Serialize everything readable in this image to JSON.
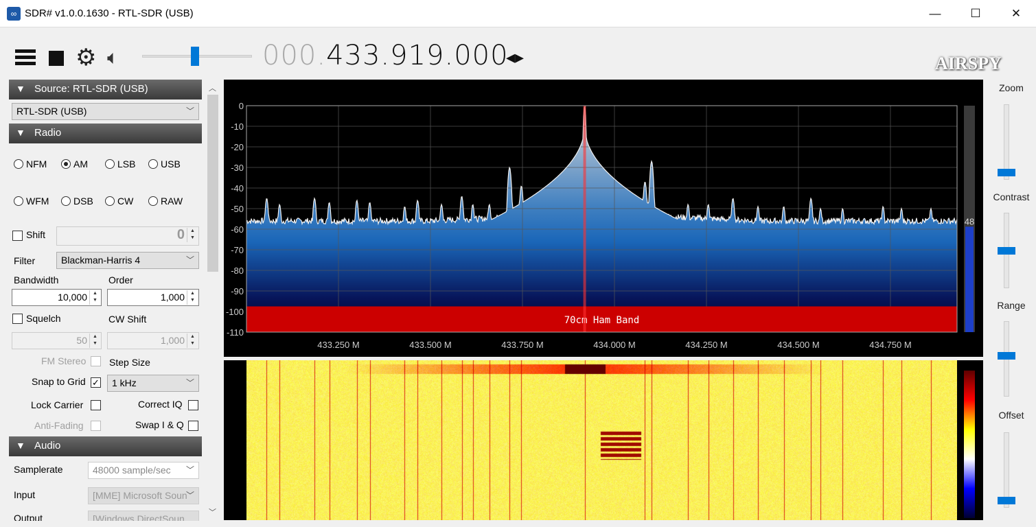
{
  "window": {
    "title": "SDR# v1.0.0.1630 - RTL-SDR (USB)",
    "minimize": "—",
    "maximize": "☐",
    "close": "✕"
  },
  "toolbar": {
    "icons": [
      "menu-icon",
      "stop-icon",
      "gear-icon",
      "speaker-icon"
    ],
    "volume_percent": 48,
    "frequency_prefix": "000.",
    "frequency_main": "433.919.000",
    "tune_arrows": "◂▸",
    "logo": "AIRSPY"
  },
  "source": {
    "header": "Source: RTL-SDR (USB)",
    "device": "RTL-SDR (USB)"
  },
  "radio": {
    "header": "Radio",
    "modes": [
      {
        "label": "NFM",
        "selected": false
      },
      {
        "label": "AM",
        "selected": true
      },
      {
        "label": "LSB",
        "selected": false
      },
      {
        "label": "USB",
        "selected": false
      },
      {
        "label": "WFM",
        "selected": false
      },
      {
        "label": "DSB",
        "selected": false
      },
      {
        "label": "CW",
        "selected": false
      },
      {
        "label": "RAW",
        "selected": false
      }
    ],
    "shift_label": "Shift",
    "shift_value": "0",
    "filter_label": "Filter",
    "filter_value": "Blackman-Harris 4",
    "bandwidth_label": "Bandwidth",
    "bandwidth_value": "10,000",
    "order_label": "Order",
    "order_value": "1,000",
    "squelch_label": "Squelch",
    "squelch_value": "50",
    "cwshift_label": "CW Shift",
    "cwshift_value": "1,000",
    "fmstereo_label": "FM Stereo",
    "stepsize_label": "Step Size",
    "snap_label": "Snap to Grid",
    "snap_checked": true,
    "stepsize_value": "1 kHz",
    "lockcarrier_label": "Lock Carrier",
    "correctiq_label": "Correct IQ",
    "antifading_label": "Anti-Fading",
    "swapiq_label": "Swap I & Q"
  },
  "audio": {
    "header": "Audio",
    "samplerate_label": "Samplerate",
    "samplerate_value": "48000 sample/sec",
    "input_label": "Input",
    "input_value": "[MME] Microsoft Soun",
    "output_label": "Output",
    "output_value": "[Windows DirectSoun"
  },
  "spectrum": {
    "center_mhz": 433.919,
    "start_mhz": 433.0,
    "end_mhz": 434.931,
    "y_ticks": [
      "0",
      "-10",
      "-20",
      "-30",
      "-40",
      "-50",
      "-60",
      "-70",
      "-80",
      "-90",
      "-100",
      "-110"
    ],
    "x_ticks": [
      "433.250 M",
      "433.500 M",
      "433.750 M",
      "434.000 M",
      "434.250 M",
      "434.500 M",
      "434.750 M"
    ],
    "band_label": "70cm Ham Band",
    "band_color": "#cc0000",
    "level_value": "48",
    "noise_floor_db": -56,
    "peaks": [
      [
        433.919,
        0
      ],
      [
        433.715,
        -30
      ],
      [
        433.747,
        -39
      ],
      [
        434.101,
        -27
      ],
      [
        434.083,
        -37
      ],
      [
        433.585,
        -44
      ],
      [
        434.322,
        -45
      ],
      [
        434.534,
        -45
      ],
      [
        433.055,
        -45
      ],
      [
        433.185,
        -45
      ],
      [
        433.3,
        -46
      ],
      [
        433.465,
        -46
      ],
      [
        433.66,
        -48
      ],
      [
        434.2,
        -48
      ],
      [
        434.46,
        -49
      ],
      [
        434.73,
        -49
      ],
      [
        434.62,
        -50
      ],
      [
        433.225,
        -47
      ],
      [
        433.335,
        -47
      ],
      [
        433.43,
        -49
      ],
      [
        433.53,
        -48
      ],
      [
        433.615,
        -48
      ],
      [
        434.255,
        -48
      ],
      [
        434.39,
        -49
      ],
      [
        434.56,
        -50
      ],
      [
        434.78,
        -50
      ],
      [
        434.86,
        -50
      ],
      [
        433.09,
        -48
      ]
    ]
  },
  "waterfall": {
    "colormap": [
      "#000030",
      "#0000ff",
      "#ffffff",
      "#ffff00",
      "#ff0000",
      "#600000"
    ]
  },
  "right_controls": {
    "zoom_label": "Zoom",
    "zoom_level": 0.05,
    "contrast_label": "Contrast",
    "contrast_level": 0.5,
    "range_label": "Range",
    "range_level": 0.55,
    "offset_label": "Offset",
    "offset_level": 0.05
  }
}
